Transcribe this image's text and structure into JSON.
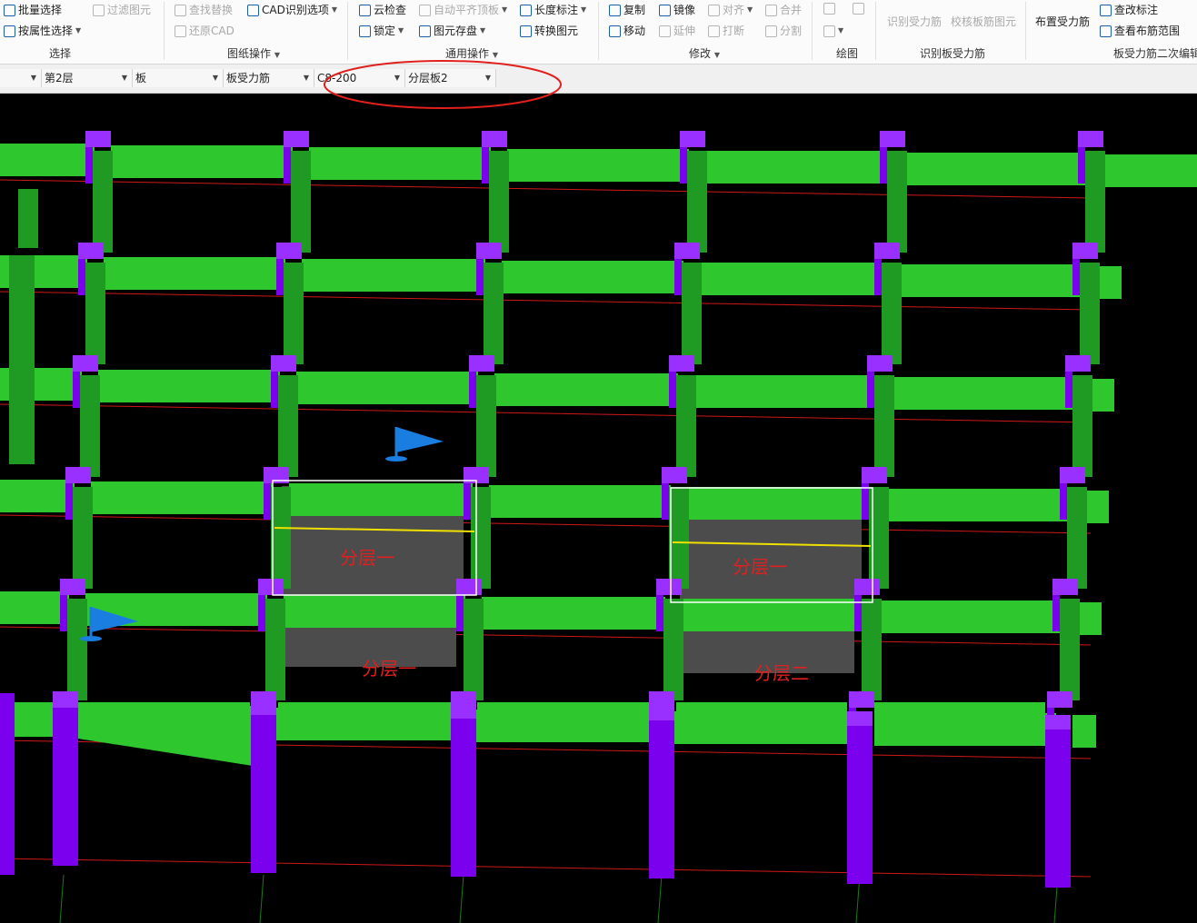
{
  "ribbon": {
    "groups": [
      {
        "label": "选择",
        "items": [
          {
            "label": "批量选择",
            "icon": "batch-select-icon",
            "enabled": true
          },
          {
            "label": "过滤图元",
            "icon": "filter-icon",
            "enabled": false
          },
          {
            "label": "按属性选择",
            "icon": "property-select-icon",
            "enabled": true
          }
        ]
      },
      {
        "label": "图纸操作",
        "items": [
          {
            "label": "查找替换",
            "icon": "find-replace-icon",
            "enabled": false
          },
          {
            "label": "CAD识别选项",
            "icon": "cad-options-icon",
            "enabled": true
          },
          {
            "label": "还原CAD",
            "icon": "restore-cad-icon",
            "enabled": false
          }
        ]
      },
      {
        "label": "通用操作",
        "items": [
          {
            "label": "云检查",
            "icon": "cloud-check-icon",
            "enabled": true
          },
          {
            "label": "自动平齐顶板",
            "icon": "auto-align-icon",
            "enabled": false
          },
          {
            "label": "长度标注",
            "icon": "length-dimension-icon",
            "enabled": true
          },
          {
            "label": "锁定",
            "icon": "lock-icon",
            "enabled": true
          },
          {
            "label": "图元存盘",
            "icon": "save-element-icon",
            "enabled": true
          },
          {
            "label": "转换图元",
            "icon": "convert-element-icon",
            "enabled": true
          }
        ]
      },
      {
        "label": "修改",
        "items": [
          {
            "label": "复制",
            "icon": "copy-icon",
            "enabled": true
          },
          {
            "label": "镜像",
            "icon": "mirror-icon",
            "enabled": true
          },
          {
            "label": "对齐",
            "icon": "align-icon",
            "enabled": false
          },
          {
            "label": "合并",
            "icon": "merge-icon",
            "enabled": false
          },
          {
            "label": "移动",
            "icon": "move-icon",
            "enabled": true
          },
          {
            "label": "延伸",
            "icon": "extend-icon",
            "enabled": false
          },
          {
            "label": "打断",
            "icon": "break-icon",
            "enabled": false
          },
          {
            "label": "分割",
            "icon": "split-icon",
            "enabled": false
          }
        ]
      },
      {
        "label": "绘图",
        "items": []
      },
      {
        "label": "识别板受力筋",
        "items": [
          {
            "label": "识别受力筋",
            "icon": "identify-rebar-icon",
            "enabled": false
          },
          {
            "label": "校核板筋图元",
            "icon": "check-rebar-icon",
            "enabled": false
          }
        ]
      },
      {
        "label": "板受力筋二次编辑",
        "items": [
          {
            "label": "布置受力筋",
            "icon": "place-rebar-icon",
            "enabled": true
          },
          {
            "label": "查改标注",
            "icon": "edit-annotation-icon",
            "enabled": true
          },
          {
            "label": "查看布筋范围",
            "icon": "view-range-icon",
            "enabled": true
          }
        ]
      }
    ]
  },
  "property_bar": {
    "floor": "第2层",
    "category": "板",
    "type": "板受力筋",
    "spec": "C8-200",
    "layer": "分层板2"
  },
  "canvas": {
    "labels": [
      "分层一",
      "分层一",
      "分层一",
      "分层二"
    ],
    "colors": {
      "background": "#000000",
      "beam": "#2ec82e",
      "beam_shade": "#1f9a22",
      "column": "#7a00ee",
      "column_edge": "#9a30ff",
      "grid_line": "#d01818",
      "slab": "#4c4c4c",
      "selection": "#ffffff",
      "rebar": "#f0e000",
      "label": "#e02020",
      "flag": "#1a7de0"
    }
  }
}
